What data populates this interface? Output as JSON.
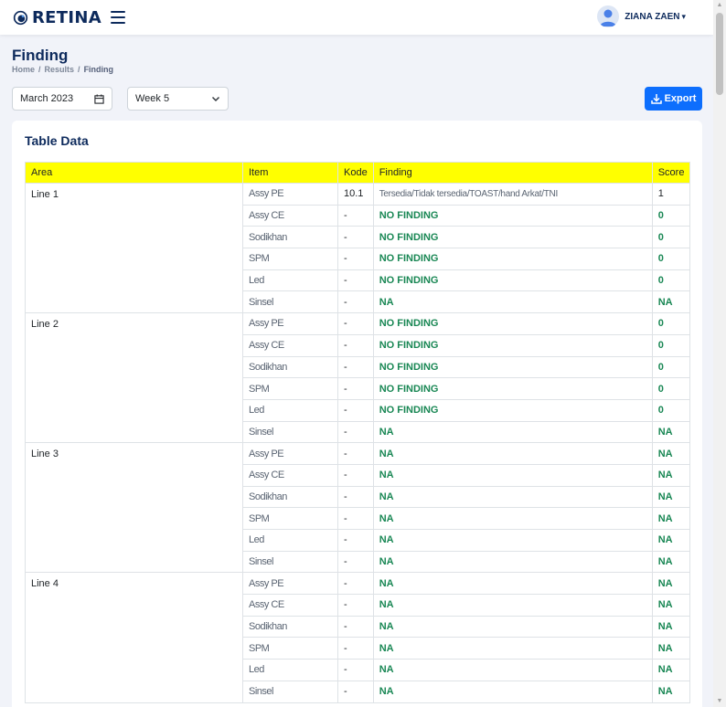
{
  "header": {
    "app_name": "RETINA",
    "user_name": "ZIANA ZAEN",
    "user_caret": "▾"
  },
  "page": {
    "title": "Finding",
    "breadcrumb": [
      "Home",
      "Results",
      "Finding"
    ]
  },
  "filters": {
    "month_value": "March 2023",
    "week_value": "Week 5"
  },
  "export_label": "Export",
  "card": {
    "title": "Table Data"
  },
  "table": {
    "columns": [
      "Area",
      "Item",
      "Kode",
      "Finding",
      "Score"
    ],
    "groups": [
      {
        "area": "Line 1",
        "rows": [
          {
            "item": "Assy PE",
            "kode": "10.1",
            "finding": "Tersedia/Tidak tersedia/TOAST/hand Arkat/TNI",
            "score": "1"
          },
          {
            "item": "Assy CE",
            "kode": "-",
            "finding": "NO FINDING",
            "score": "0"
          },
          {
            "item": "Sodikhan",
            "kode": "-",
            "finding": "NO FINDING",
            "score": "0"
          },
          {
            "item": "SPM",
            "kode": "-",
            "finding": "NO FINDING",
            "score": "0"
          },
          {
            "item": "Led",
            "kode": "-",
            "finding": "NO FINDING",
            "score": "0"
          },
          {
            "item": "Sinsel",
            "kode": "-",
            "finding": "NA",
            "score": "NA"
          }
        ]
      },
      {
        "area": "Line 2",
        "rows": [
          {
            "item": "Assy PE",
            "kode": "-",
            "finding": "NO FINDING",
            "score": "0"
          },
          {
            "item": "Assy CE",
            "kode": "-",
            "finding": "NO FINDING",
            "score": "0"
          },
          {
            "item": "Sodikhan",
            "kode": "-",
            "finding": "NO FINDING",
            "score": "0"
          },
          {
            "item": "SPM",
            "kode": "-",
            "finding": "NO FINDING",
            "score": "0"
          },
          {
            "item": "Led",
            "kode": "-",
            "finding": "NO FINDING",
            "score": "0"
          },
          {
            "item": "Sinsel",
            "kode": "-",
            "finding": "NA",
            "score": "NA"
          }
        ]
      },
      {
        "area": "Line 3",
        "rows": [
          {
            "item": "Assy PE",
            "kode": "-",
            "finding": "NA",
            "score": "NA"
          },
          {
            "item": "Assy CE",
            "kode": "-",
            "finding": "NA",
            "score": "NA"
          },
          {
            "item": "Sodikhan",
            "kode": "-",
            "finding": "NA",
            "score": "NA"
          },
          {
            "item": "SPM",
            "kode": "-",
            "finding": "NA",
            "score": "NA"
          },
          {
            "item": "Led",
            "kode": "-",
            "finding": "NA",
            "score": "NA"
          },
          {
            "item": "Sinsel",
            "kode": "-",
            "finding": "NA",
            "score": "NA"
          }
        ]
      },
      {
        "area": "Line 4",
        "rows": [
          {
            "item": "Assy PE",
            "kode": "-",
            "finding": "NA",
            "score": "NA"
          },
          {
            "item": "Assy CE",
            "kode": "-",
            "finding": "NA",
            "score": "NA"
          },
          {
            "item": "Sodikhan",
            "kode": "-",
            "finding": "NA",
            "score": "NA"
          },
          {
            "item": "SPM",
            "kode": "-",
            "finding": "NA",
            "score": "NA"
          },
          {
            "item": "Led",
            "kode": "-",
            "finding": "NA",
            "score": "NA"
          },
          {
            "item": "Sinsel",
            "kode": "-",
            "finding": "NA",
            "score": "NA"
          }
        ]
      }
    ]
  },
  "colors": {
    "brand": "#0d2a5c",
    "primary": "#0d6efd",
    "header_yellow": "#ffff00",
    "green": "#198754"
  }
}
